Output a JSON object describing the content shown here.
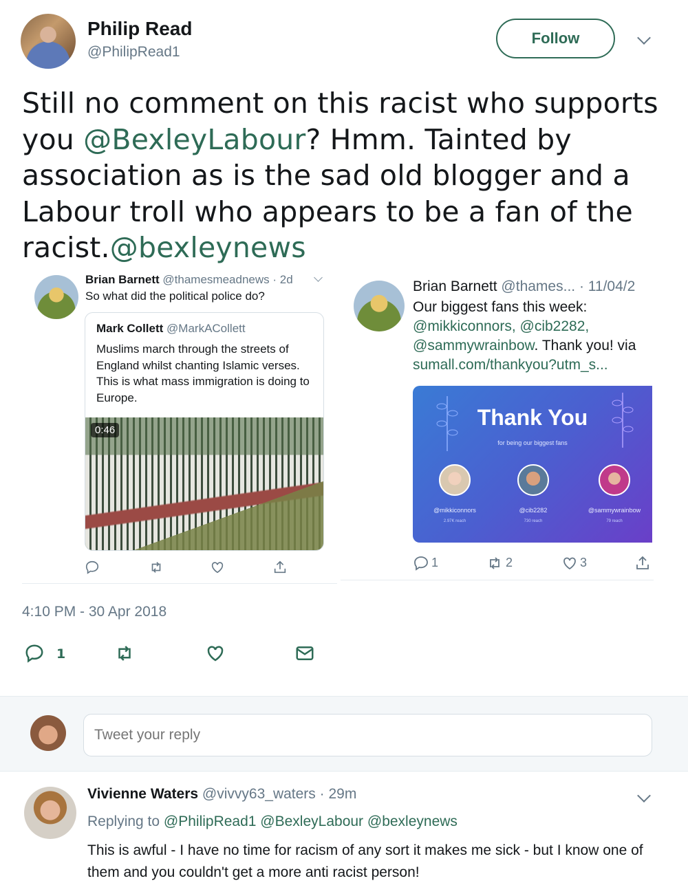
{
  "main_tweet": {
    "author_name": "Philip Read",
    "author_handle": "@PhilipRead1",
    "follow_label": "Follow",
    "text_parts": {
      "t1": "Still no comment on this racist who supports you ",
      "m1": "@BexleyLabour",
      "t2": "? Hmm. Tainted by association as is the sad old blogger and a Labour troll who appears to be a fan of the racist.",
      "m2": "@bexleynews"
    },
    "timestamp": "4:10 PM - 30 Apr 2018",
    "reply_count": "1"
  },
  "embedded_left": {
    "author_name": "Brian Barnett",
    "author_handle": "@thamesmeadnews",
    "time": "· 2d",
    "text": "So what did the political police do?",
    "quoted": {
      "author_name": "Mark Collett",
      "author_handle": "@MarkACollett",
      "text": "Muslims march through the streets of England whilst chanting Islamic verses. This is what mass immigration is doing to Europe.",
      "video_duration": "0:46"
    }
  },
  "embedded_right": {
    "author_name": "Brian Barnett",
    "author_handle": "@thames...",
    "time": "· 11/04/2",
    "text_lead": "Our biggest fans this week:",
    "mentions": "@mikkiconnors, @cib2282,",
    "mention3": "@sammywrainbow",
    "text_tail": ". Thank you! via",
    "link": "sumall.com/thankyou?utm_s...",
    "card": {
      "title": "Thank You",
      "subtitle": "for being our biggest fans",
      "fans": [
        {
          "handle": "@mikkiconnors",
          "reach": "2.97K reach"
        },
        {
          "handle": "@cib2282",
          "reach": "730 reach"
        },
        {
          "handle": "@sammywrainbow",
          "reach": "79 reach"
        }
      ]
    },
    "reply_count": "1",
    "retweet_count": "2",
    "like_count": "3"
  },
  "reply_box": {
    "placeholder": "Tweet your reply"
  },
  "reply_tweet": {
    "author_name": "Vivienne Waters",
    "author_handle": "@vivvy63_waters",
    "time": "· 29m",
    "replying_label": "Replying to",
    "replying_handles": "@PhilipRead1 @BexleyLabour @bexleynews",
    "text": "This is awful - I have no time for racism of any sort it makes me sick - but I know one of them and you couldn't get a more anti racist person!"
  },
  "colors": {
    "link": "#2e6b56",
    "muted": "#657786",
    "card_gradient_start": "#3a7bd5",
    "card_gradient_end": "#6a3fc8"
  }
}
